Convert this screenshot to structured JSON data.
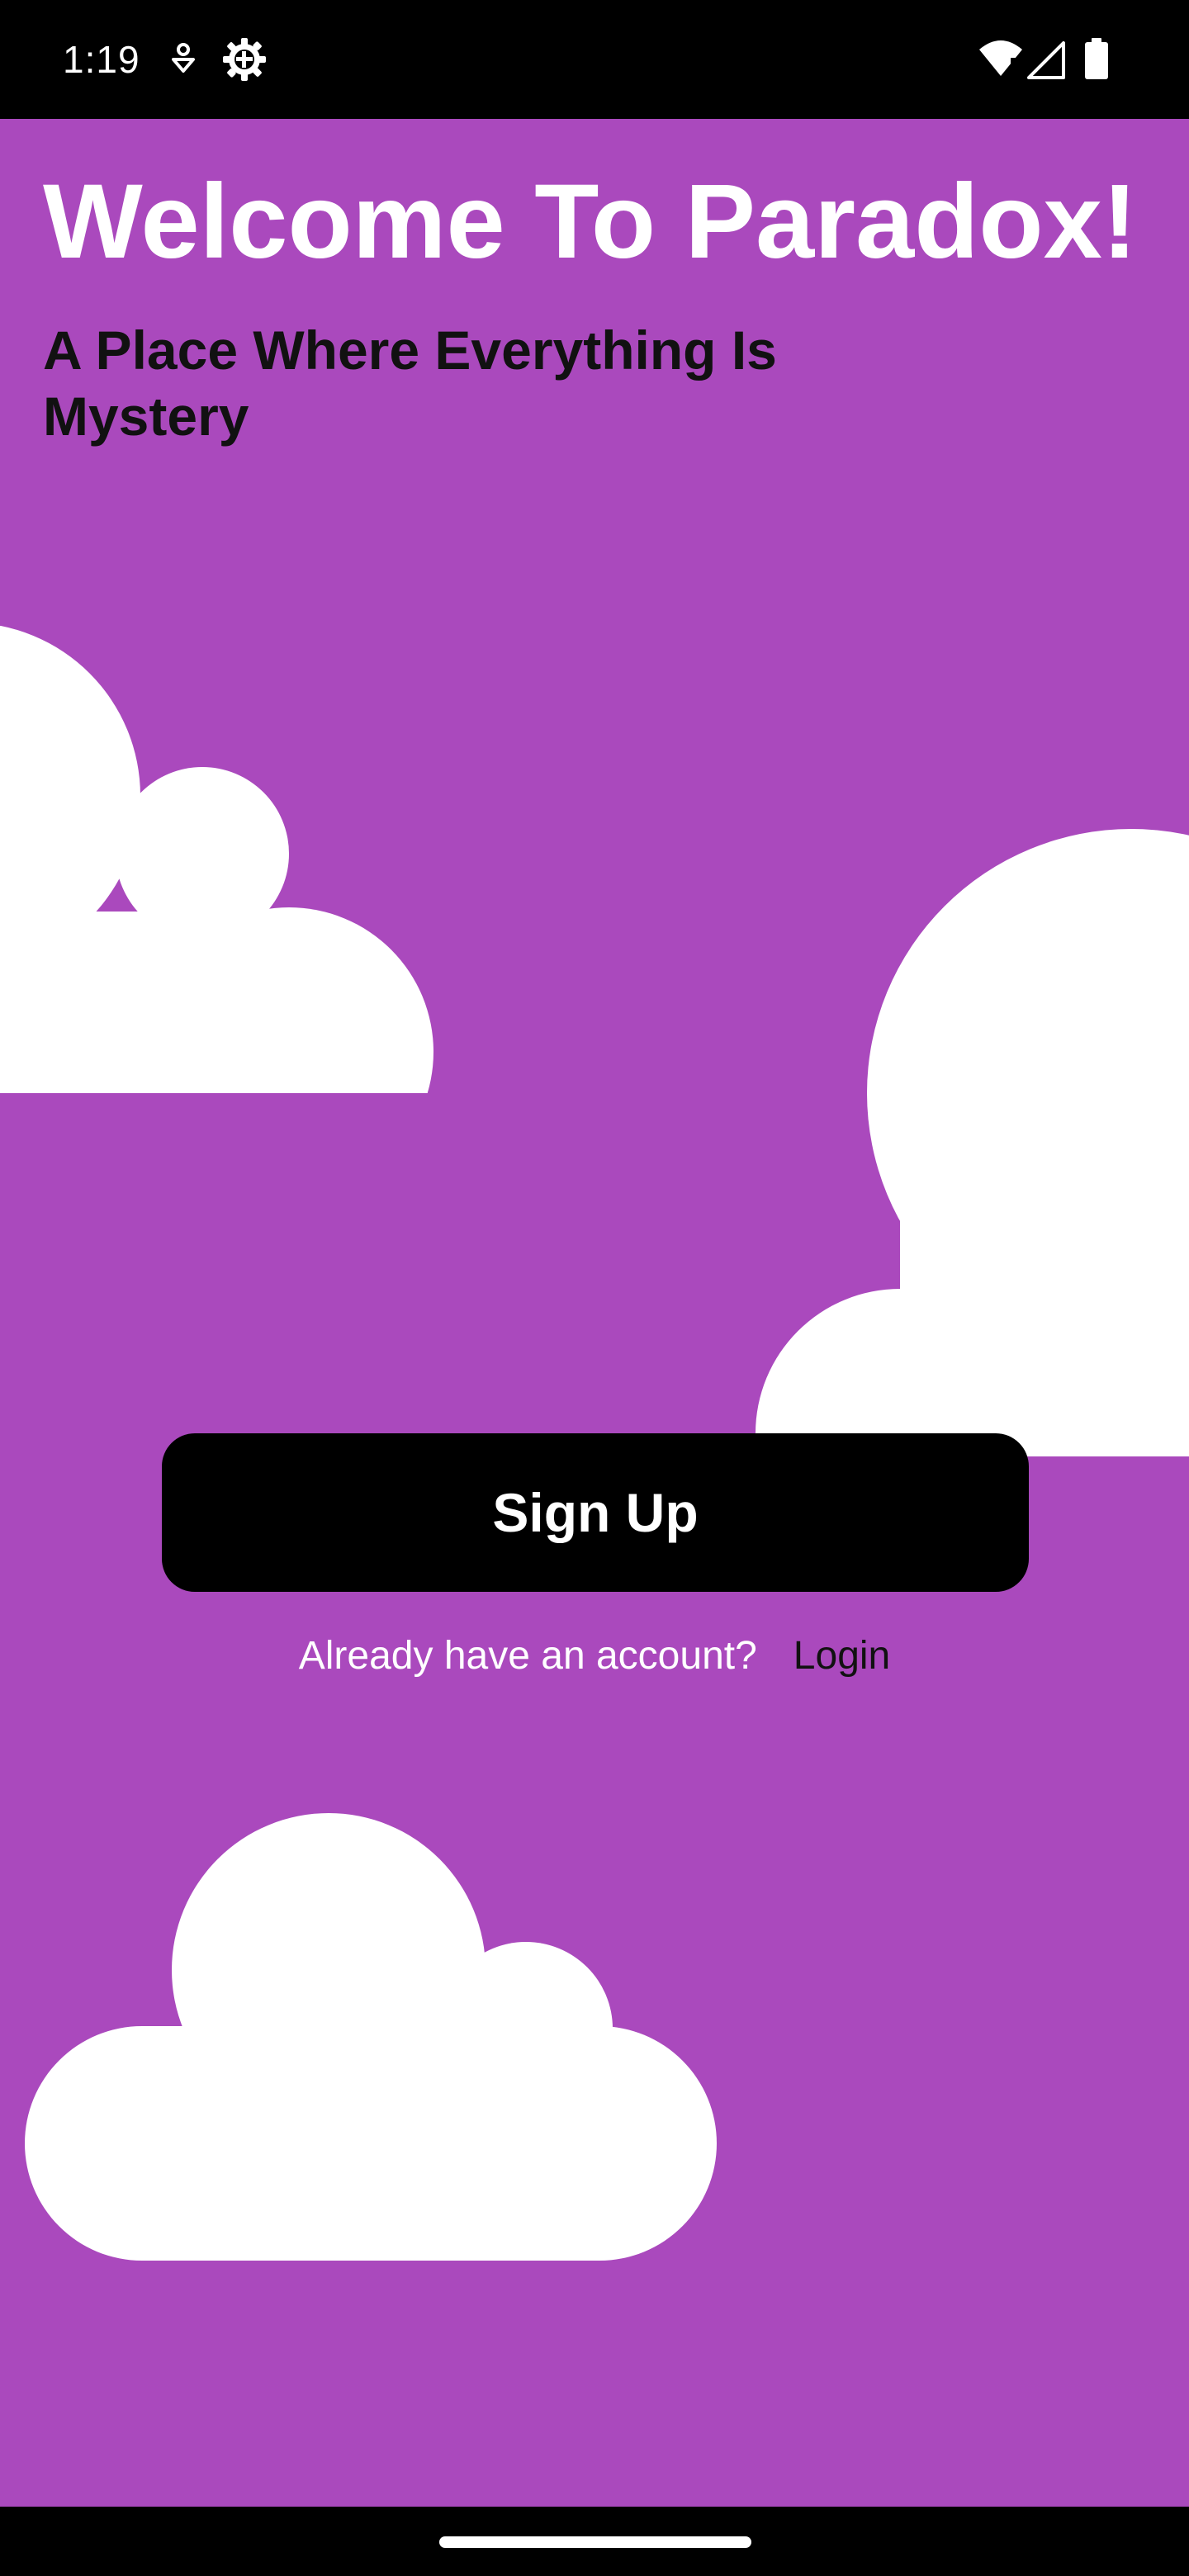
{
  "status_bar": {
    "time": "1:19",
    "icons": [
      "notification-icon",
      "settings-gear-icon",
      "wifi-icon",
      "cell-signal-icon",
      "battery-icon"
    ]
  },
  "welcome": {
    "title": "Welcome To Paradox!",
    "subtitle": "A Place Where Everything Is Mystery"
  },
  "actions": {
    "signup_label": "Sign Up",
    "login_prompt": "Already have an account?",
    "login_label": "Login"
  },
  "colors": {
    "background": "#aa49bd",
    "title": "#ffffff",
    "subtitle": "#111111",
    "button": "#000000",
    "button_text": "#ffffff",
    "cloud": "#ffffff"
  }
}
